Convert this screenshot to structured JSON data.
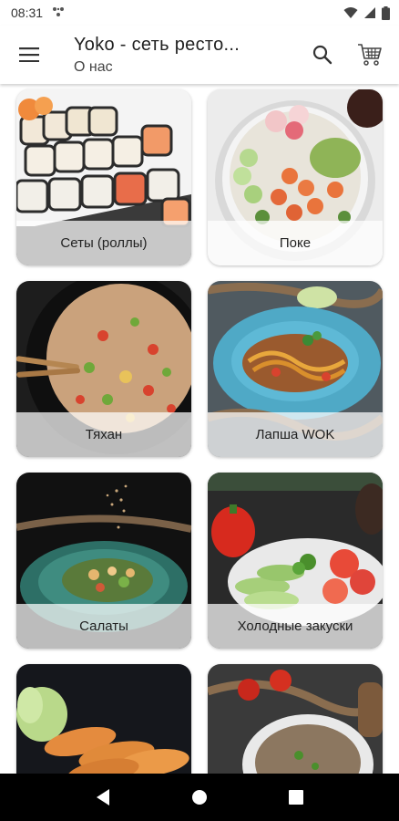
{
  "status_bar": {
    "time": "08:31",
    "icons": [
      "notification-icon",
      "wifi-icon",
      "cellular-signal-icon",
      "battery-icon"
    ]
  },
  "app_bar": {
    "title": "Yoko - сеть ресто...",
    "subtitle": "О нас",
    "icons": [
      "menu-icon",
      "search-icon",
      "cart-icon"
    ]
  },
  "categories": [
    {
      "label": "Сеты (роллы)"
    },
    {
      "label": "Поке"
    },
    {
      "label": "Тяхан"
    },
    {
      "label": "Лапша WOK"
    },
    {
      "label": "Салаты"
    },
    {
      "label": "Холодные закуски"
    },
    {
      "label": ""
    },
    {
      "label": ""
    }
  ],
  "nav_bar": {
    "icons": [
      "back-icon",
      "home-icon",
      "recents-icon"
    ]
  },
  "colors": {
    "app_bar_background": "#ffffff",
    "nav_bar_background": "#000000",
    "label_band": "rgba(255,255,255,0.72)",
    "text": "#222222"
  }
}
